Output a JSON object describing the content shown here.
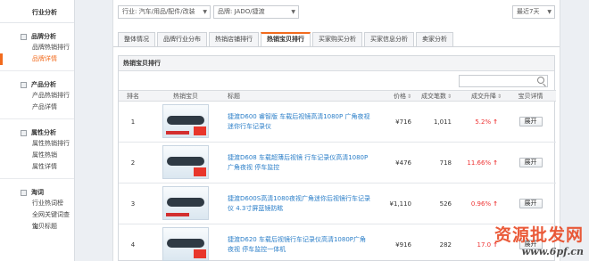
{
  "sidebar": {
    "top": "行业分析",
    "groups": [
      {
        "title": "品牌分析",
        "items": [
          "品牌热销排行",
          "品牌详情"
        ]
      },
      {
        "title": "产品分析",
        "items": [
          "产品热销排行",
          "产品详情"
        ]
      },
      {
        "title": "属性分析",
        "items": [
          "属性热销排行",
          "属性热销",
          "属性详情"
        ]
      },
      {
        "title": "淘词",
        "items": [
          "行业热词榜",
          "全网关键词查询",
          "宝贝标题"
        ]
      }
    ]
  },
  "filters": {
    "industry": "行业: 汽车/用品/配件/改装",
    "brand": "品牌: JADO/捷渡",
    "period": "最近7天"
  },
  "tabs": [
    "整体情况",
    "品牌行业分布",
    "热销店铺排行",
    "热销宝贝排行",
    "买家购买分析",
    "买家信息分析",
    "卖家分析"
  ],
  "panel": {
    "title": "热销宝贝排行"
  },
  "table": {
    "headers": [
      "排名",
      "热销宝贝",
      "标题",
      "价格",
      "成交笔数",
      "成交升降",
      "宝贝详情"
    ],
    "rows": [
      {
        "rank": "1",
        "title": "捷渡D600 睿智版 车载后视镜高清1080P 广角夜视迷你行车记录仪",
        "price": "¥716",
        "deals": "1,011",
        "change": "5.2%",
        "detail": "展开"
      },
      {
        "rank": "2",
        "title": "捷渡D608 车载超薄后视镜 行车记录仪高清1080P广角夜视 停车监控",
        "price": "¥476",
        "deals": "718",
        "change": "11.66%",
        "detail": "展开"
      },
      {
        "rank": "3",
        "title": "捷渡D600S高清1080夜视广角迷你后视镜行车记录仪 4.3寸屏蓝镜防眩",
        "price": "¥1,110",
        "deals": "526",
        "change": "0.96%",
        "detail": "展开"
      },
      {
        "rank": "4",
        "title": "捷渡D620 车载后视镜行车记录仪高清1080P广角夜视 停车监控一体机",
        "price": "¥916",
        "deals": "282",
        "change": "17.0",
        "detail": "展开"
      }
    ]
  },
  "watermark": {
    "line1": "资源批发网",
    "line2": "www.6pf.cn"
  },
  "colors": {
    "accent": "#f26b1d",
    "link": "#2a7ec8",
    "up": "#e33333"
  }
}
